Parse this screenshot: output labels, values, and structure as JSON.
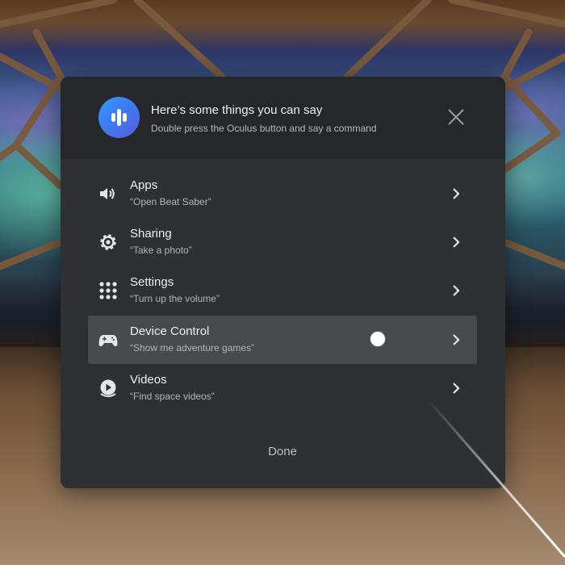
{
  "header": {
    "title": "Here’s some things you can say",
    "subtitle": "Double press the Oculus button and say a command",
    "mic_icon": "microphone-waveform-icon",
    "close_icon": "close-icon"
  },
  "commands": [
    {
      "label": "Apps",
      "example": "“Open Beat Saber”",
      "icon": "speaker-icon",
      "active": false
    },
    {
      "label": "Sharing",
      "example": "“Take a photo”",
      "icon": "gear-icon",
      "active": false
    },
    {
      "label": "Settings",
      "example": "“Turn up the volume”",
      "icon": "grid-icon",
      "active": false
    },
    {
      "label": "Device Control",
      "example": "“Show me adventure games”",
      "icon": "gamepad-icon",
      "active": true
    },
    {
      "label": "Videos",
      "example": "“Find space videos”",
      "icon": "play-icon",
      "active": false
    }
  ],
  "footer": {
    "done_label": "Done"
  },
  "colors": {
    "panel": "#2f3033",
    "header": "#26272a",
    "active_row": "#48494c",
    "mic_gradient_start": "#3a9bff",
    "mic_gradient_end": "#5a5fe0"
  }
}
